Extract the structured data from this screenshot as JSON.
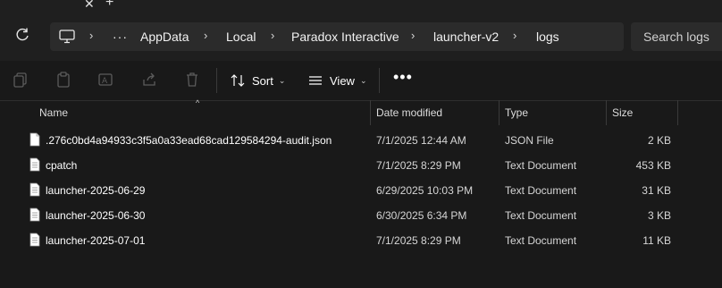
{
  "tabs": {
    "close_glyph": "✕",
    "new_glyph": "+"
  },
  "breadcrumb": {
    "overflow": "···",
    "items": [
      "AppData",
      "Local",
      "Paradox Interactive",
      "launcher-v2",
      "logs"
    ],
    "separator": "›"
  },
  "search": {
    "placeholder": "Search logs"
  },
  "toolbar": {
    "sort_label": "Sort",
    "view_label": "View",
    "more_label": "•••",
    "dropdown_glyph": "⌄"
  },
  "columns": {
    "name": "Name",
    "date_modified": "Date modified",
    "type": "Type",
    "size": "Size",
    "sort_glyph": "^"
  },
  "files": [
    {
      "name": ".276c0bd4a94933c3f5a0a33ead68cad129584294-audit.json",
      "date": "7/1/2025 12:44 AM",
      "type": "JSON File",
      "size": "2 KB"
    },
    {
      "name": "cpatch",
      "date": "7/1/2025 8:29 PM",
      "type": "Text Document",
      "size": "453 KB"
    },
    {
      "name": "launcher-2025-06-29",
      "date": "6/29/2025 10:03 PM",
      "type": "Text Document",
      "size": "31 KB"
    },
    {
      "name": "launcher-2025-06-30",
      "date": "6/30/2025 6:34 PM",
      "type": "Text Document",
      "size": "3 KB"
    },
    {
      "name": "launcher-2025-07-01",
      "date": "7/1/2025 8:29 PM",
      "type": "Text Document",
      "size": "11 KB"
    }
  ],
  "colors": {
    "background": "#191919",
    "chrome": "#1f1f1f",
    "field": "#2b2b2b",
    "text": "#ffffff",
    "muted": "#6a6a6a"
  }
}
